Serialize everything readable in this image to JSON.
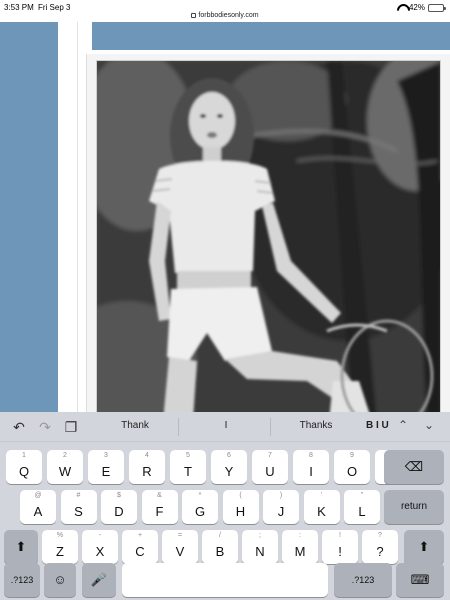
{
  "status_bar": {
    "time": "3:53 PM",
    "date": "Fri Sep 3",
    "url": "forbbodiesonly.com",
    "battery_percent": "42%",
    "battery_level": 0.42
  },
  "colors": {
    "site_blue": "#6e96b8",
    "keyboard_bg": "#d3d5dc",
    "key_dark": "#adb1b9"
  },
  "keyboard": {
    "toolbar": {
      "undo_icon": "undo-icon",
      "redo_icon": "redo-icon",
      "clipboard_icon": "clipboard-icon",
      "suggestions": [
        "Thank",
        "I",
        "Thanks"
      ],
      "format_label": "B I U"
    },
    "row1": [
      {
        "main": "Q",
        "alt": "1"
      },
      {
        "main": "W",
        "alt": "2"
      },
      {
        "main": "E",
        "alt": "3"
      },
      {
        "main": "R",
        "alt": "4"
      },
      {
        "main": "T",
        "alt": "5"
      },
      {
        "main": "Y",
        "alt": "6"
      },
      {
        "main": "U",
        "alt": "7"
      },
      {
        "main": "I",
        "alt": "8"
      },
      {
        "main": "O",
        "alt": "9"
      },
      {
        "main": "P",
        "alt": "0"
      }
    ],
    "row2": [
      {
        "main": "A",
        "alt": "@"
      },
      {
        "main": "S",
        "alt": "#"
      },
      {
        "main": "D",
        "alt": "$"
      },
      {
        "main": "F",
        "alt": "&"
      },
      {
        "main": "G",
        "alt": "*"
      },
      {
        "main": "H",
        "alt": "("
      },
      {
        "main": "J",
        "alt": ")"
      },
      {
        "main": "K",
        "alt": "'"
      },
      {
        "main": "L",
        "alt": "\""
      }
    ],
    "row3": [
      {
        "main": "Z",
        "alt": "%"
      },
      {
        "main": "X",
        "alt": "-"
      },
      {
        "main": "C",
        "alt": "+"
      },
      {
        "main": "V",
        "alt": "="
      },
      {
        "main": "B",
        "alt": "/"
      },
      {
        "main": "N",
        "alt": ";"
      },
      {
        "main": "M",
        "alt": ":"
      },
      {
        "main": "!",
        "alt": "!"
      },
      {
        "main": "?",
        "alt": "?"
      }
    ],
    "return_label": "return",
    "numbers_label": ".?123",
    "numbers_label_right": ".?123"
  }
}
